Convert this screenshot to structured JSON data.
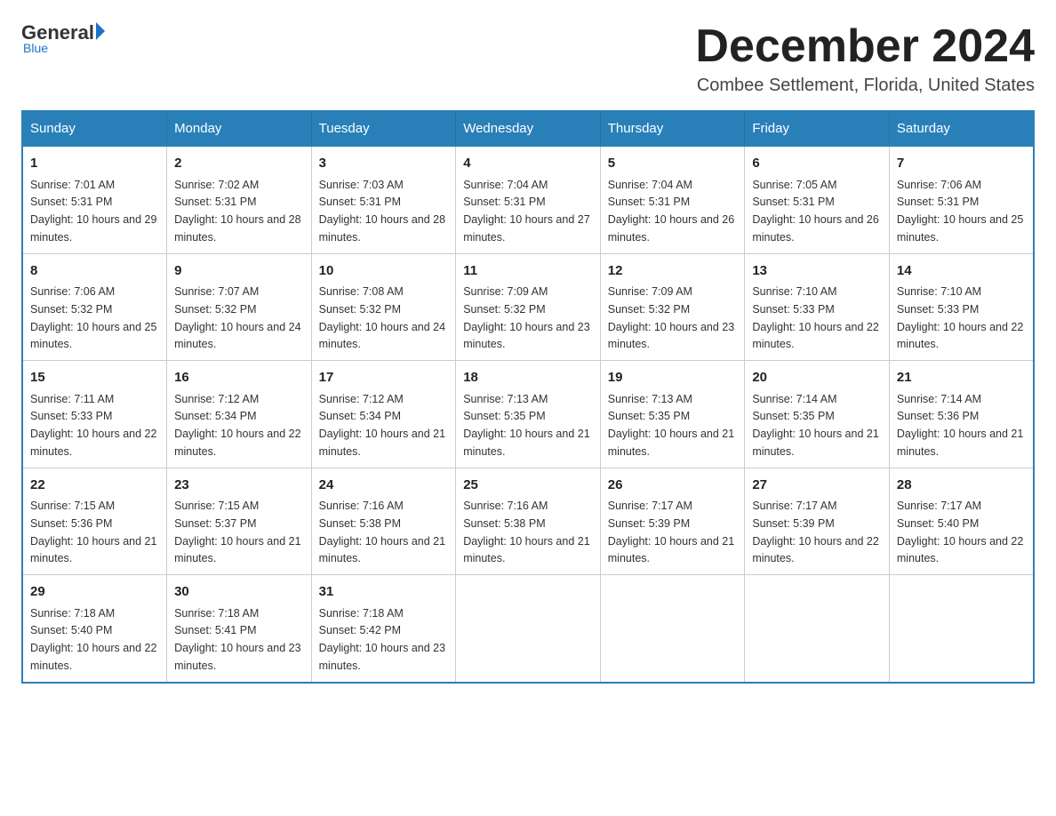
{
  "header": {
    "logo": {
      "general": "General",
      "blue": "Blue",
      "underline": "Blue"
    },
    "title": "December 2024",
    "location": "Combee Settlement, Florida, United States"
  },
  "days_of_week": [
    "Sunday",
    "Monday",
    "Tuesday",
    "Wednesday",
    "Thursday",
    "Friday",
    "Saturday"
  ],
  "weeks": [
    [
      {
        "day": "1",
        "sunrise": "7:01 AM",
        "sunset": "5:31 PM",
        "daylight": "10 hours and 29 minutes."
      },
      {
        "day": "2",
        "sunrise": "7:02 AM",
        "sunset": "5:31 PM",
        "daylight": "10 hours and 28 minutes."
      },
      {
        "day": "3",
        "sunrise": "7:03 AM",
        "sunset": "5:31 PM",
        "daylight": "10 hours and 28 minutes."
      },
      {
        "day": "4",
        "sunrise": "7:04 AM",
        "sunset": "5:31 PM",
        "daylight": "10 hours and 27 minutes."
      },
      {
        "day": "5",
        "sunrise": "7:04 AM",
        "sunset": "5:31 PM",
        "daylight": "10 hours and 26 minutes."
      },
      {
        "day": "6",
        "sunrise": "7:05 AM",
        "sunset": "5:31 PM",
        "daylight": "10 hours and 26 minutes."
      },
      {
        "day": "7",
        "sunrise": "7:06 AM",
        "sunset": "5:31 PM",
        "daylight": "10 hours and 25 minutes."
      }
    ],
    [
      {
        "day": "8",
        "sunrise": "7:06 AM",
        "sunset": "5:32 PM",
        "daylight": "10 hours and 25 minutes."
      },
      {
        "day": "9",
        "sunrise": "7:07 AM",
        "sunset": "5:32 PM",
        "daylight": "10 hours and 24 minutes."
      },
      {
        "day": "10",
        "sunrise": "7:08 AM",
        "sunset": "5:32 PM",
        "daylight": "10 hours and 24 minutes."
      },
      {
        "day": "11",
        "sunrise": "7:09 AM",
        "sunset": "5:32 PM",
        "daylight": "10 hours and 23 minutes."
      },
      {
        "day": "12",
        "sunrise": "7:09 AM",
        "sunset": "5:32 PM",
        "daylight": "10 hours and 23 minutes."
      },
      {
        "day": "13",
        "sunrise": "7:10 AM",
        "sunset": "5:33 PM",
        "daylight": "10 hours and 22 minutes."
      },
      {
        "day": "14",
        "sunrise": "7:10 AM",
        "sunset": "5:33 PM",
        "daylight": "10 hours and 22 minutes."
      }
    ],
    [
      {
        "day": "15",
        "sunrise": "7:11 AM",
        "sunset": "5:33 PM",
        "daylight": "10 hours and 22 minutes."
      },
      {
        "day": "16",
        "sunrise": "7:12 AM",
        "sunset": "5:34 PM",
        "daylight": "10 hours and 22 minutes."
      },
      {
        "day": "17",
        "sunrise": "7:12 AM",
        "sunset": "5:34 PM",
        "daylight": "10 hours and 21 minutes."
      },
      {
        "day": "18",
        "sunrise": "7:13 AM",
        "sunset": "5:35 PM",
        "daylight": "10 hours and 21 minutes."
      },
      {
        "day": "19",
        "sunrise": "7:13 AM",
        "sunset": "5:35 PM",
        "daylight": "10 hours and 21 minutes."
      },
      {
        "day": "20",
        "sunrise": "7:14 AM",
        "sunset": "5:35 PM",
        "daylight": "10 hours and 21 minutes."
      },
      {
        "day": "21",
        "sunrise": "7:14 AM",
        "sunset": "5:36 PM",
        "daylight": "10 hours and 21 minutes."
      }
    ],
    [
      {
        "day": "22",
        "sunrise": "7:15 AM",
        "sunset": "5:36 PM",
        "daylight": "10 hours and 21 minutes."
      },
      {
        "day": "23",
        "sunrise": "7:15 AM",
        "sunset": "5:37 PM",
        "daylight": "10 hours and 21 minutes."
      },
      {
        "day": "24",
        "sunrise": "7:16 AM",
        "sunset": "5:38 PM",
        "daylight": "10 hours and 21 minutes."
      },
      {
        "day": "25",
        "sunrise": "7:16 AM",
        "sunset": "5:38 PM",
        "daylight": "10 hours and 21 minutes."
      },
      {
        "day": "26",
        "sunrise": "7:17 AM",
        "sunset": "5:39 PM",
        "daylight": "10 hours and 21 minutes."
      },
      {
        "day": "27",
        "sunrise": "7:17 AM",
        "sunset": "5:39 PM",
        "daylight": "10 hours and 22 minutes."
      },
      {
        "day": "28",
        "sunrise": "7:17 AM",
        "sunset": "5:40 PM",
        "daylight": "10 hours and 22 minutes."
      }
    ],
    [
      {
        "day": "29",
        "sunrise": "7:18 AM",
        "sunset": "5:40 PM",
        "daylight": "10 hours and 22 minutes."
      },
      {
        "day": "30",
        "sunrise": "7:18 AM",
        "sunset": "5:41 PM",
        "daylight": "10 hours and 23 minutes."
      },
      {
        "day": "31",
        "sunrise": "7:18 AM",
        "sunset": "5:42 PM",
        "daylight": "10 hours and 23 minutes."
      },
      null,
      null,
      null,
      null
    ]
  ]
}
